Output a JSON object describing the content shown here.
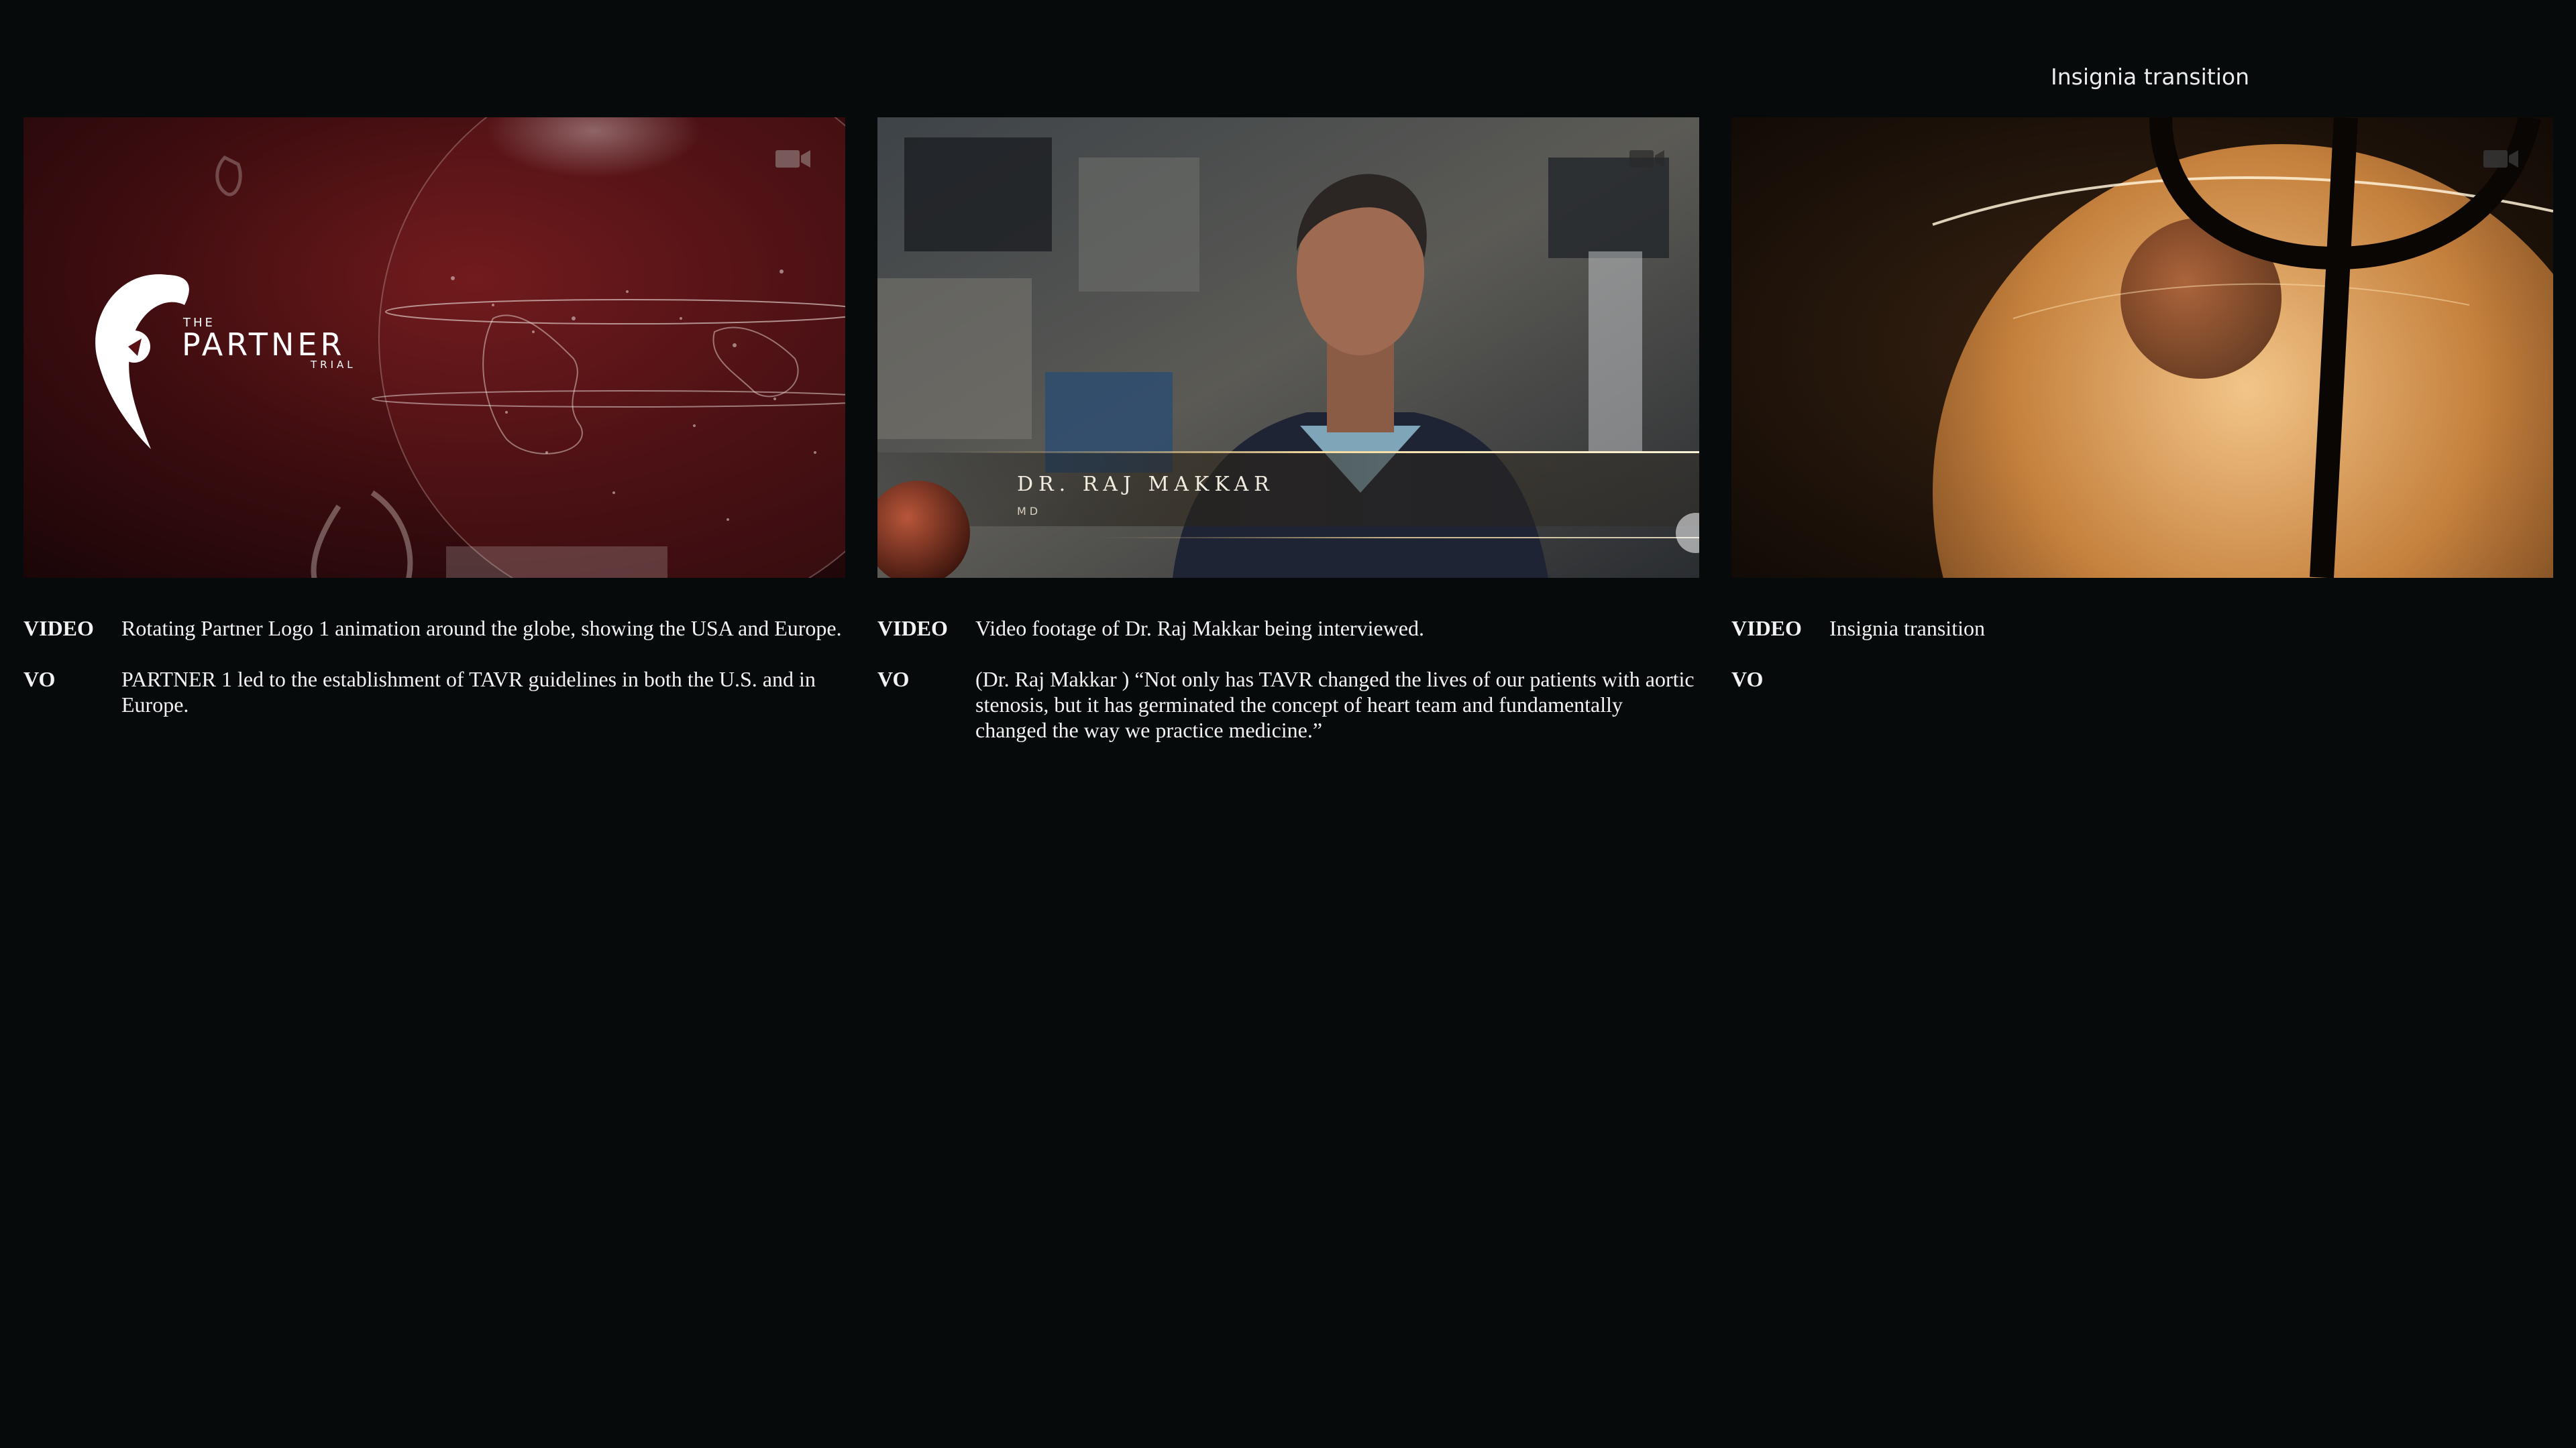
{
  "top_caption": "Insignia transition",
  "frames": [
    {
      "logo": {
        "the": "THE",
        "main": "PARTNER",
        "trial": "TRIAL"
      },
      "video_key": "VIDEO",
      "video_text": "Rotating Partner Logo 1 animation around the globe, showing the USA and Europe.",
      "vo_key": "VO",
      "vo_text": "PARTNER 1 led to the establishment of TAVR guidelines in both the U.S. and in Europe."
    },
    {
      "lower_third": {
        "name": "DR. RAJ MAKKAR",
        "title": "MD"
      },
      "video_key": "VIDEO",
      "video_text": "Video footage of Dr. Raj Makkar being interviewed.",
      "vo_key": "VO",
      "vo_text": "(Dr. Raj Makkar ) “Not only has TAVR changed the lives of our patients with aortic stenosis, but it has germinated the concept of heart team and fundamentally changed the way we practice medicine.”"
    },
    {
      "video_key": "VIDEO",
      "video_text": "Insignia transition",
      "vo_key": "VO",
      "vo_text": ""
    }
  ],
  "colors": {
    "background": "#060a0b",
    "frame1_red": "#5a1214",
    "frame3_gold": "#d99a4a"
  },
  "icons": [
    "video-camera-icon"
  ]
}
